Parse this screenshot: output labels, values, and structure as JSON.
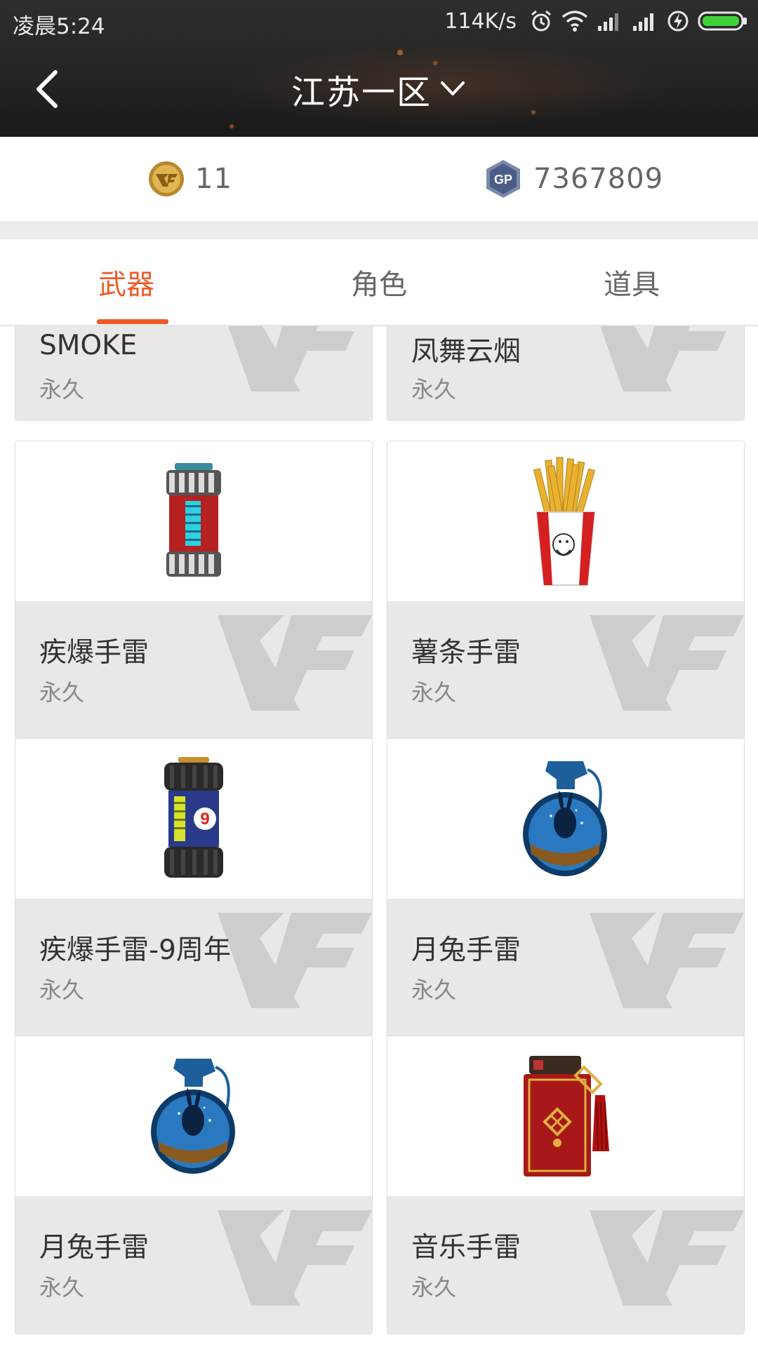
{
  "status_bar": {
    "time": "凌晨5:24",
    "net_speed": "114K/s"
  },
  "header": {
    "title": "江苏一区",
    "back_icon": "chevron-left-icon",
    "dropdown_icon": "chevron-down-icon"
  },
  "currency": {
    "cf_points": "11",
    "gp": "7367809"
  },
  "tabs": [
    {
      "label": "武器",
      "active": true
    },
    {
      "label": "角色",
      "active": false
    },
    {
      "label": "道具",
      "active": false
    }
  ],
  "items": [
    {
      "name": "SMOKE",
      "duration": "永久"
    },
    {
      "name": "凤舞云烟",
      "duration": "永久"
    },
    {
      "name": "疾爆手雷",
      "duration": "永久",
      "image": "canister-grenade-icon"
    },
    {
      "name": "薯条手雷",
      "duration": "永久",
      "image": "fries-grenade-icon"
    },
    {
      "name": "疾爆手雷-9周年",
      "duration": "永久",
      "image": "anniversary-canister-icon"
    },
    {
      "name": "月兔手雷",
      "duration": "永久",
      "image": "moon-rabbit-grenade-icon"
    },
    {
      "name": "月兔手雷",
      "duration": "永久",
      "image": "moon-rabbit-grenade-icon"
    },
    {
      "name": "音乐手雷",
      "duration": "永久",
      "image": "music-box-grenade-icon"
    }
  ],
  "colors": {
    "accent": "#f05a28",
    "header_bg": "#262626",
    "card_info_bg": "#eae8e6"
  }
}
